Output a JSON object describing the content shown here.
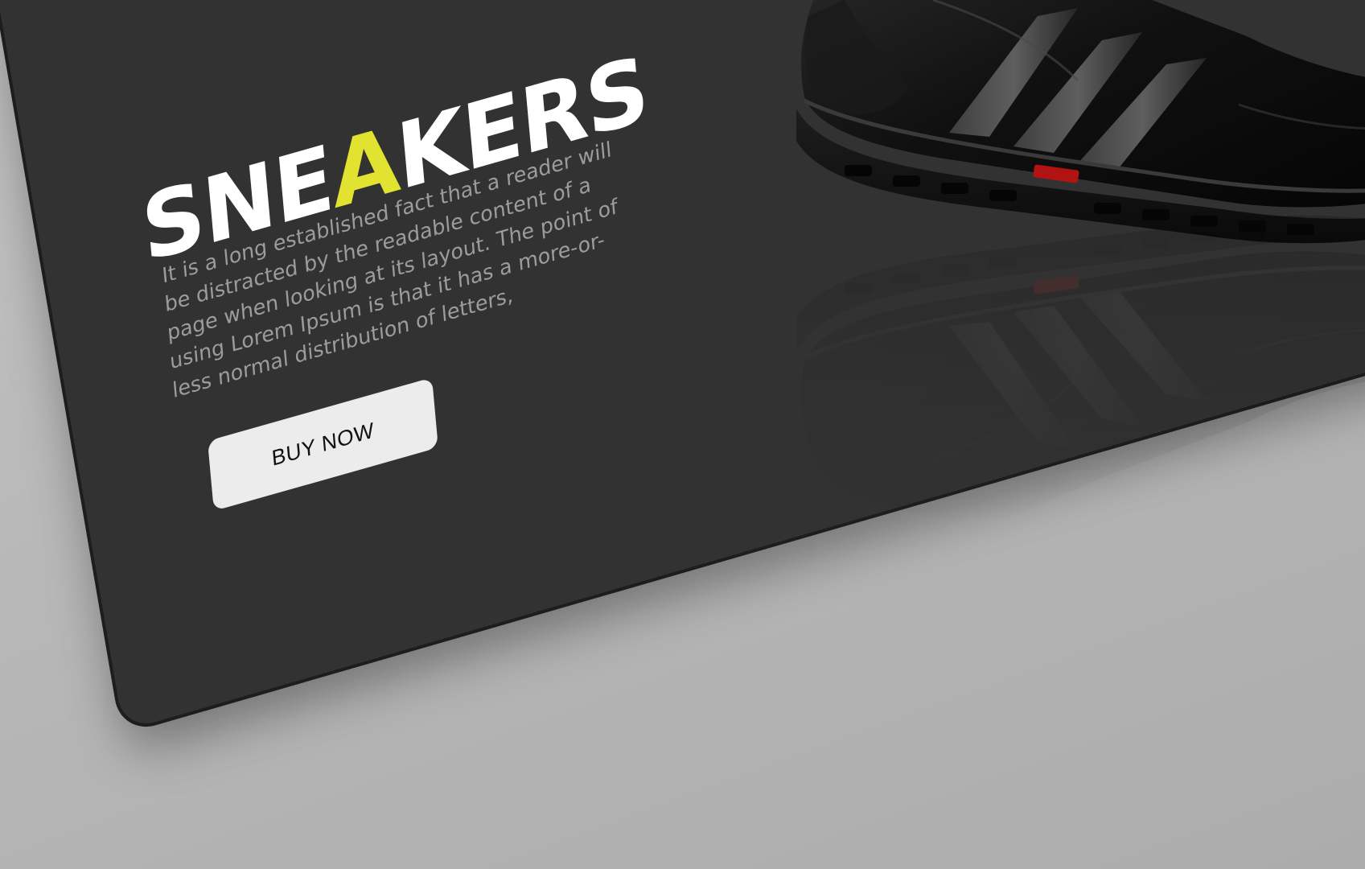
{
  "hero": {
    "title_before": "SNE",
    "title_accent": "A",
    "title_after": "KERS",
    "description": "It is a long established fact that a reader will be distracted by the readable content of a page when looking at its layout. The point of using Lorem Ipsum is that it has a more-or-less normal distribution of letters,",
    "cta_label": "BUY NOW"
  },
  "colors": {
    "background": "#b1b1b1",
    "card": "#323232",
    "accent": "#e2e231",
    "title": "#ffffff",
    "text": "#9c9c9c",
    "button": "#ececec"
  },
  "icons": {
    "product_image": "black-sneaker-illustration"
  }
}
